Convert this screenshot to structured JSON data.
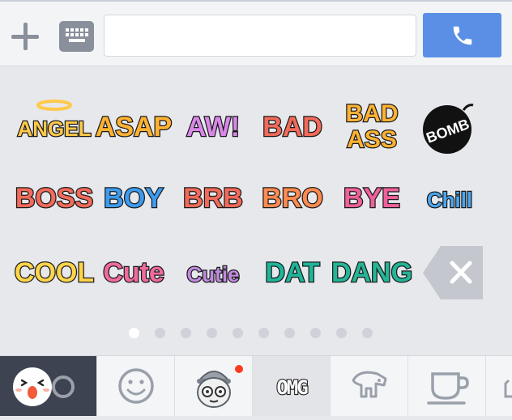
{
  "input": {
    "value": "",
    "placeholder": ""
  },
  "stickers": [
    {
      "name": "sticker-angel",
      "text": "ANGEL",
      "fill": "#ffc94a",
      "stroke": "#1a1a1a",
      "style": "outline"
    },
    {
      "name": "sticker-asap",
      "text": "ASAP",
      "fill": "#ffb232",
      "stroke": "#1a1a1a",
      "style": "outline"
    },
    {
      "name": "sticker-aw",
      "text": "AW!",
      "fill": "#d987e8",
      "stroke": "#1a1a1a",
      "style": "outline"
    },
    {
      "name": "sticker-bad",
      "text": "BAD",
      "fill": "#f26a5a",
      "stroke": "#1a1a1a",
      "style": "outline"
    },
    {
      "name": "sticker-bad-ass",
      "text": "BAD ASS",
      "fill": "#ffb232",
      "stroke": "#1a1a1a",
      "style": "outline"
    },
    {
      "name": "sticker-bomb",
      "text": "BOMB",
      "fill": "#ffffff",
      "stroke": "#111111",
      "style": "bomb"
    },
    {
      "name": "sticker-boss",
      "text": "BOSS",
      "fill": "#f26a5a",
      "stroke": "#1a1a1a",
      "style": "outline"
    },
    {
      "name": "sticker-boy",
      "text": "BOY",
      "fill": "#3b9cf0",
      "stroke": "#1a1a1a",
      "style": "outline"
    },
    {
      "name": "sticker-brb",
      "text": "BRB",
      "fill": "#f26a5a",
      "stroke": "#1a1a1a",
      "style": "outline"
    },
    {
      "name": "sticker-bro",
      "text": "BRO",
      "fill": "#ff8a50",
      "stroke": "#1a1a1a",
      "style": "outline"
    },
    {
      "name": "sticker-bye",
      "text": "BYE",
      "fill": "#f0609a",
      "stroke": "#1a1a1a",
      "style": "outline"
    },
    {
      "name": "sticker-chill",
      "text": "Chill",
      "fill": "#4aa6f0",
      "stroke": "#1a1a1a",
      "style": "outline"
    },
    {
      "name": "sticker-cool",
      "text": "COOL",
      "fill": "#ffd54a",
      "stroke": "#1a1a1a",
      "style": "outline"
    },
    {
      "name": "sticker-cute",
      "text": "Cute",
      "fill": "#f06aa0",
      "stroke": "#1a1a1a",
      "style": "outline"
    },
    {
      "name": "sticker-cutie",
      "text": "Cutie",
      "fill": "#c28ae0",
      "stroke": "#1a1a1a",
      "style": "outline"
    },
    {
      "name": "sticker-dat",
      "text": "DAT",
      "fill": "#1fb59a",
      "stroke": "#1a1a1a",
      "style": "outline"
    },
    {
      "name": "sticker-dang",
      "text": "DANG",
      "fill": "#23b596",
      "stroke": "#1a1a1a",
      "style": "outline"
    }
  ],
  "pagination": {
    "count": 10,
    "active": 0
  },
  "tabs": [
    {
      "name": "tab-brown-face",
      "icon": "brown-bear-icon"
    },
    {
      "name": "tab-recent",
      "icon": "clock-icon"
    },
    {
      "name": "tab-emoji",
      "icon": "smiley-icon"
    },
    {
      "name": "tab-character",
      "icon": "character-face-icon",
      "badge": true
    },
    {
      "name": "tab-omg-text",
      "icon": "omg-icon",
      "label": "OMG"
    },
    {
      "name": "tab-animal",
      "icon": "animal-icon"
    },
    {
      "name": "tab-cup",
      "icon": "cup-icon"
    },
    {
      "name": "tab-more",
      "icon": "more-icon"
    }
  ],
  "colors": {
    "accent": "#5b8fe6",
    "badge": "#ff3b1f"
  }
}
